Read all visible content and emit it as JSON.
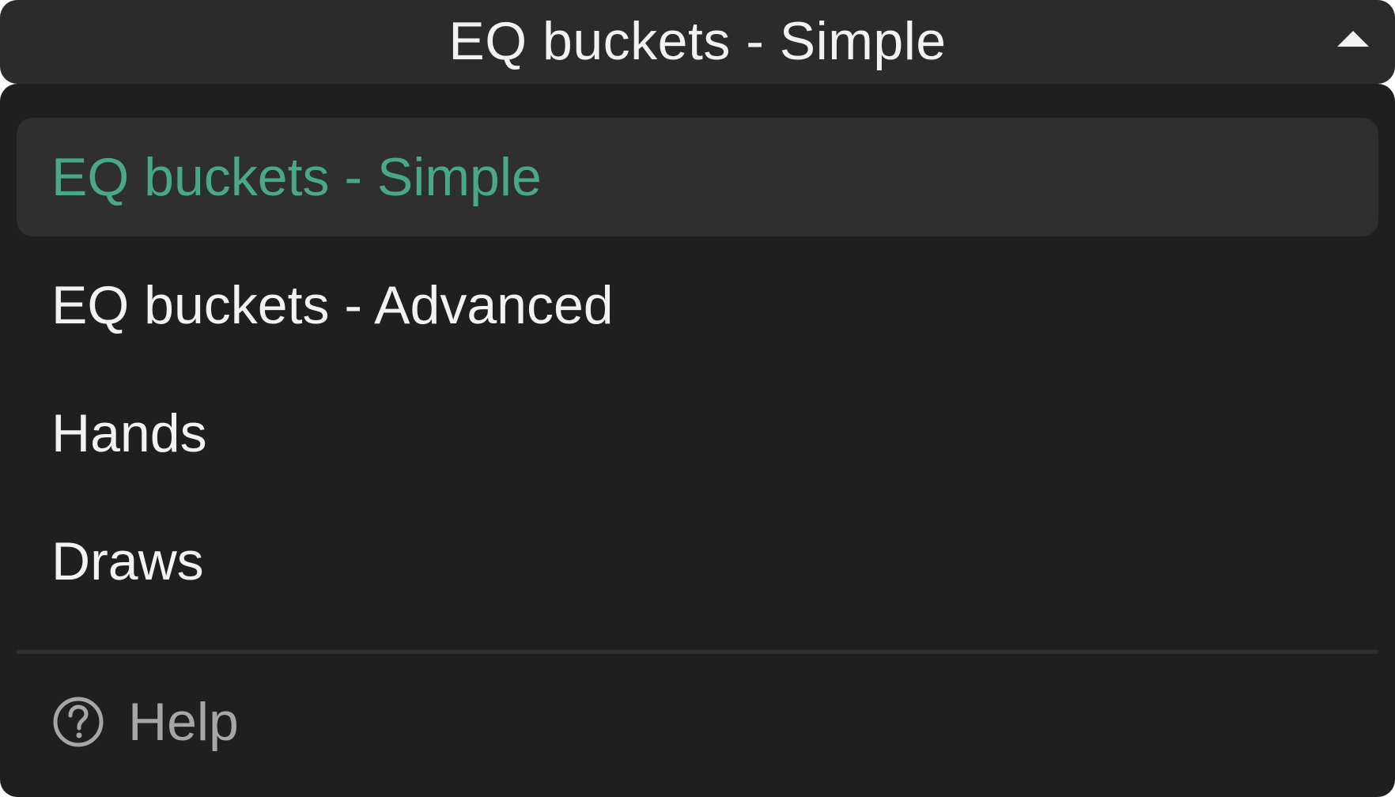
{
  "select": {
    "current_value": "EQ buckets - Simple",
    "caret_icon": "chevron-up-icon"
  },
  "options": [
    {
      "label": "EQ buckets - Simple",
      "selected": true
    },
    {
      "label": "EQ buckets - Advanced",
      "selected": false
    },
    {
      "label": "Hands",
      "selected": false
    },
    {
      "label": "Draws",
      "selected": false
    }
  ],
  "footer": {
    "help_label": "Help",
    "help_icon": "question-circle-icon"
  },
  "colors": {
    "background": "#1f1f1f",
    "header_background": "#2b2b2b",
    "selected_background": "#2f2f2f",
    "selected_text": "#4aa88a",
    "text": "#f2f2f2",
    "muted_text": "#a6a6a6"
  }
}
